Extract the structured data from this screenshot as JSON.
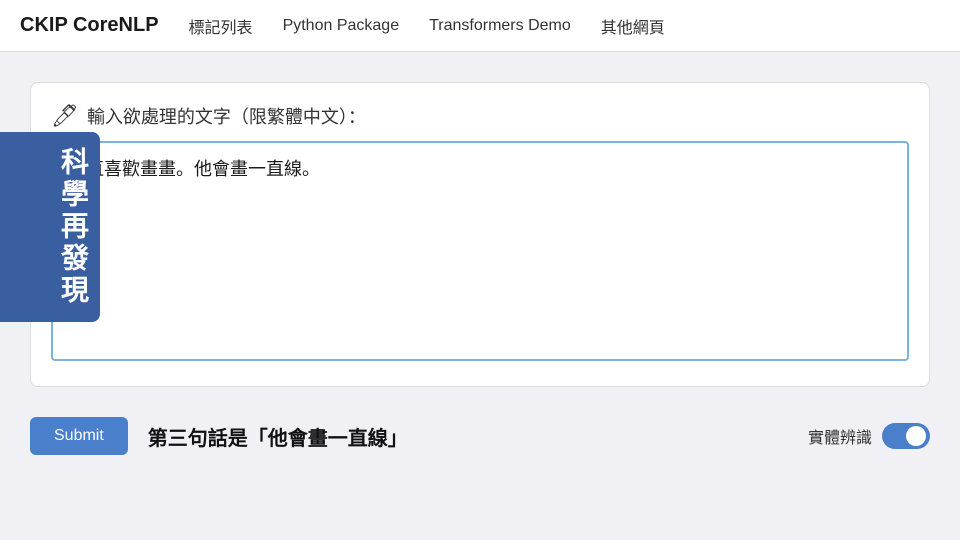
{
  "navbar": {
    "brand": "CKIP CoreNLP",
    "links": [
      {
        "label": "標記列表",
        "active": false
      },
      {
        "label": "Python Package",
        "active": true
      },
      {
        "label": "Transformers Demo",
        "active": false
      },
      {
        "label": "其他網頁",
        "active": false
      }
    ]
  },
  "watermark": {
    "text": "科學再發現"
  },
  "input_section": {
    "label_icon": "🖊",
    "label": "輸入欲處理的文字（限繁體中文）：",
    "placeholder": "",
    "value": "一直喜歡畫畫。他會畫一直線。"
  },
  "bottom": {
    "submit_label": "Submit",
    "status_text": "第三句話是「他會畫一直線」",
    "toggle_label": "實體辨識"
  }
}
